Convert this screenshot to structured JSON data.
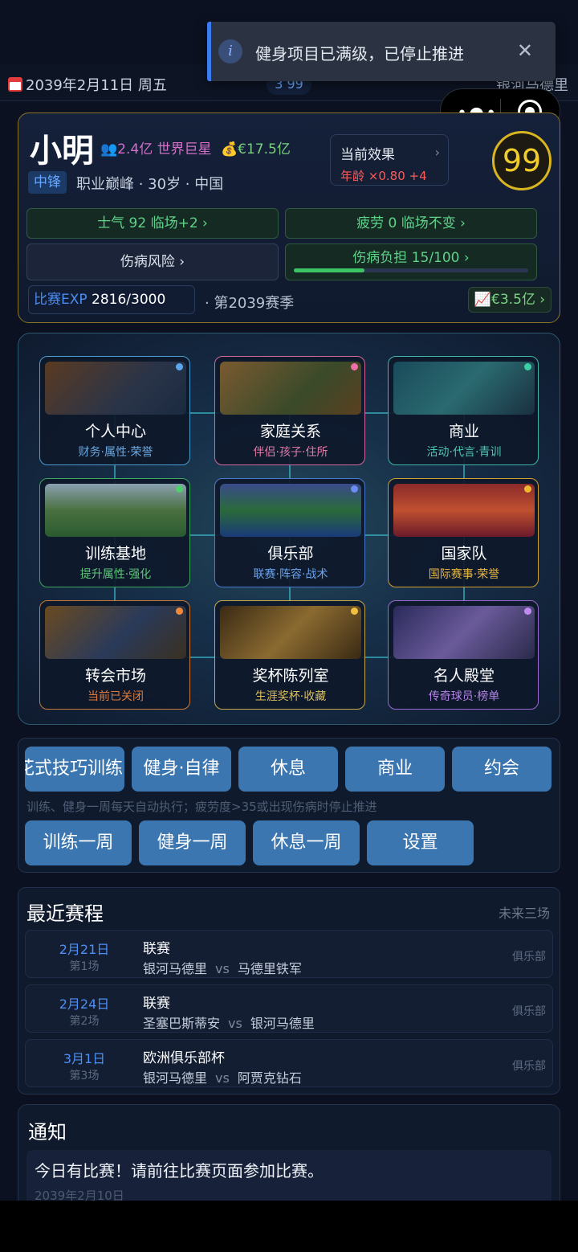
{
  "topbar": {
    "date": "2039年2月11日 周五",
    "center_tab": "3 99",
    "club": "银河马德里"
  },
  "toast": {
    "message": "健身项目已满级，已停止推进"
  },
  "player": {
    "name": "小明",
    "fans": "2.4亿 世界巨星",
    "money": "€17.5亿",
    "position": "中锋",
    "meta": "职业巅峰 · 30岁 · 中国",
    "effect_title": "当前效果",
    "effect_value": "年龄 ×0.80  +4",
    "rating": "99",
    "morale": "士气 92  临场+2 ›",
    "fatigue": "疲劳 0  临场不变 ›",
    "injury_risk": "伤病风险 ›",
    "injury_load": "伤病负担 15/100 ›",
    "injury_load_value": 15,
    "exp_label": "比赛EXP",
    "exp_value": "2816/3000",
    "season": "· 第2039赛季",
    "value": "€3.5亿 ›"
  },
  "tiles": [
    {
      "title": "个人中心",
      "sub": "财务·属性·荣誉",
      "color": "#4b9ed0",
      "sub_color": "#6aa8e0",
      "dot": "#5aa7f0"
    },
    {
      "title": "家庭关系",
      "sub": "伴侣·孩子·住所",
      "color": "#d2689e",
      "sub_color": "#e07aa8",
      "dot": "#ee6fa8"
    },
    {
      "title": "商业",
      "sub": "活动·代言·青训",
      "color": "#3fb6a8",
      "sub_color": "#4cc7b3",
      "dot": "#39d1a4"
    },
    {
      "title": "训练基地",
      "sub": "提升属性·强化",
      "color": "#3da660",
      "sub_color": "#5dc878",
      "dot": "#4fcf6a"
    },
    {
      "title": "俱乐部",
      "sub": "联赛·阵容·战术",
      "color": "#4a7ad0",
      "sub_color": "#6aa0ea",
      "dot": "#6b8cf0"
    },
    {
      "title": "国家队",
      "sub": "国际赛事·荣誉",
      "color": "#d2a030",
      "sub_color": "#e6b640",
      "dot": "#f0b830"
    },
    {
      "title": "转会市场",
      "sub": "当前已关闭",
      "color": "#c87a3a",
      "sub_color": "#e07a3a",
      "dot": "#f08a3a"
    },
    {
      "title": "奖杯陈列室",
      "sub": "生涯奖杯·收藏",
      "color": "#c9a84a",
      "sub_color": "#dcbc5a",
      "dot": "#f0c040"
    },
    {
      "title": "名人殿堂",
      "sub": "传奇球员·榜单",
      "color": "#9a6ad0",
      "sub_color": "#b482e6",
      "dot": "#c08af0"
    }
  ],
  "actions": {
    "row1": [
      "花式技巧训练",
      "健身·自律",
      "休息",
      "商业",
      "约会"
    ],
    "hint": "训练、健身一周每天自动执行；疲劳度>35或出现伤病时停止推进",
    "row2": [
      "训练一周",
      "健身一周",
      "休息一周",
      "设置"
    ]
  },
  "schedule": {
    "title": "最近赛程",
    "right": "未来三场",
    "matches": [
      {
        "date": "2月21日",
        "idx": "第1场",
        "comp": "联赛",
        "home": "银河马德里",
        "vs": "vs",
        "away": "马德里铁军",
        "tag": "俱乐部"
      },
      {
        "date": "2月24日",
        "idx": "第2场",
        "comp": "联赛",
        "home": "圣塞巴斯蒂安",
        "vs": "vs",
        "away": "银河马德里",
        "tag": "俱乐部"
      },
      {
        "date": "3月1日",
        "idx": "第3场",
        "comp": "欧洲俱乐部杯",
        "home": "银河马德里",
        "vs": "vs",
        "away": "阿贾克钻石",
        "tag": "俱乐部"
      }
    ]
  },
  "notice": {
    "title": "通知",
    "message": "今日有比赛！请前往比赛页面参加比赛。",
    "date": "2039年2月10日"
  }
}
